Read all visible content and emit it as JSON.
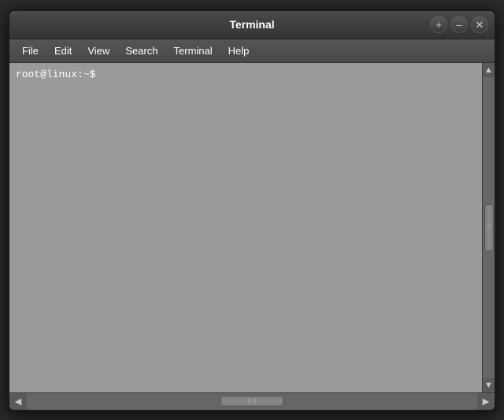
{
  "titlebar": {
    "title": "Terminal",
    "controls": {
      "add": "+",
      "minimize": "–",
      "close": "✕"
    }
  },
  "menubar": {
    "items": [
      "File",
      "Edit",
      "View",
      "Search",
      "Terminal",
      "Help"
    ]
  },
  "terminal": {
    "prompt": "root@linux:~$"
  },
  "scrollbar": {
    "up_arrow": "▲",
    "down_arrow": "▼",
    "left_arrow": "◀",
    "right_arrow": "▶"
  }
}
